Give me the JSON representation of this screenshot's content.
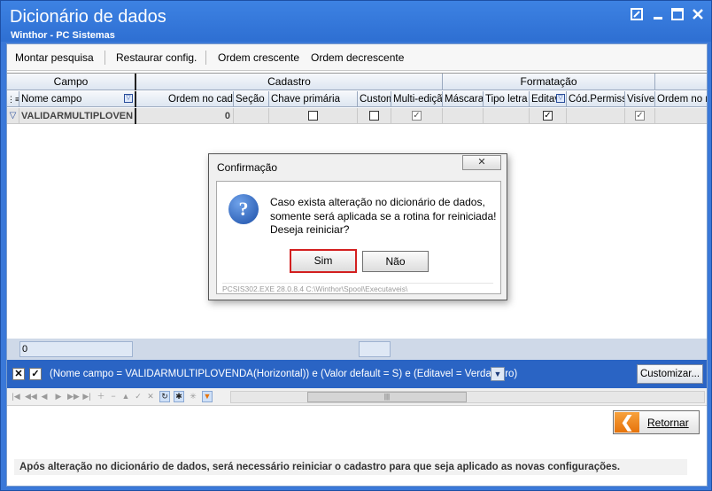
{
  "window": {
    "title": "Dicionário de dados",
    "subtitle": "Winthor - PC Sistemas",
    "controls": [
      "restore-icon",
      "minimize-icon",
      "maximize-icon",
      "close-icon"
    ]
  },
  "toolbar": {
    "items": [
      "Montar pesquisa",
      "Restaurar config.",
      "Ordem crescente",
      "Ordem decrescente"
    ]
  },
  "grid": {
    "bands": [
      "Campo",
      "Cadastro",
      "Formatação"
    ],
    "columns": [
      "Nome campo",
      "Ordem no cada",
      "Seção",
      "Chave primária",
      "Custom",
      "Multi-ediçã",
      "Máscara",
      "Tipo letra",
      "Editav",
      "Cód.Permiss",
      "Visível",
      "Ordem no r"
    ],
    "row": {
      "nome_campo": "VALIDARMULTIPLOVEN",
      "ordem": "0",
      "chave_primaria": false,
      "custom": false,
      "multi_edicao": true,
      "editavel": true,
      "visivel": true
    },
    "footer_value": "0"
  },
  "filter": {
    "text": "(Nome campo = VALIDARMULTIPLOVENDA(Horizontal)) e (Valor default = S) e (Editavel = Verdadeiro)",
    "enabled": true,
    "customize_label": "Customizar..."
  },
  "actions": {
    "return_label": "Retornar"
  },
  "info": {
    "text": "Após alteração no dicionário de dados, será necessário reiniciar o cadastro para que seja aplicado as novas configurações."
  },
  "dialog": {
    "title": "Confirmação",
    "close_glyph": "✕",
    "message": [
      "Caso exista alteração no dicionário de dados,",
      "somente será aplicada se a rotina for reiniciada!",
      "Deseja reiniciar?"
    ],
    "yes_label": "Sim",
    "no_label": "Não",
    "status": "PCSIS302.EXE 28.0.8.4 C:\\Winthor\\Spool\\Executaveis\\"
  },
  "colors": {
    "titlebar": "#2e6fd2",
    "filterbar": "#2a64c4",
    "highlight_border": "#d31f1f",
    "return_icon": "#e6730b"
  }
}
